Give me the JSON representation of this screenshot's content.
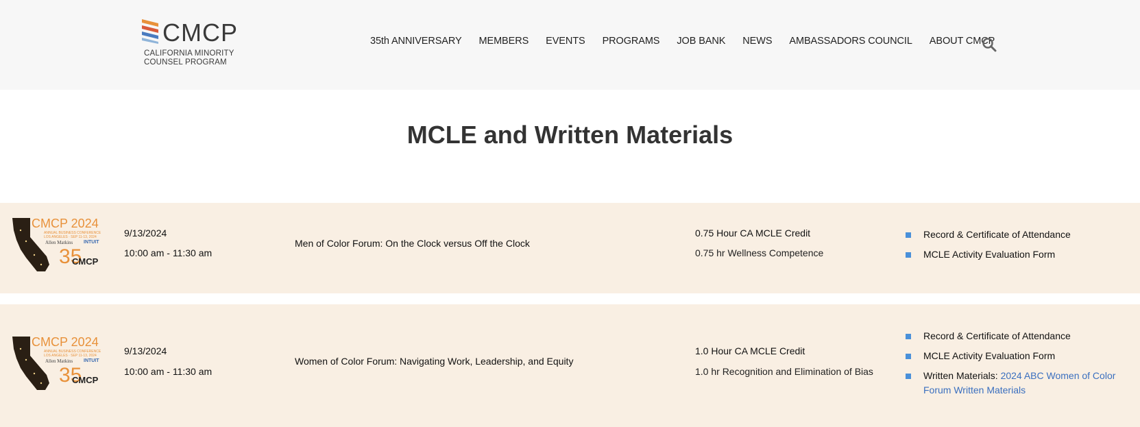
{
  "logo": {
    "word": "CMCP",
    "sub_line1": "CALIFORNIA MINORITY",
    "sub_line2": "COUNSEL PROGRAM",
    "stripe_colors": [
      "#e8913a",
      "#d95a3a",
      "#4a7bbf",
      "#8fb4d9"
    ]
  },
  "nav": {
    "items": [
      "35th ANNIVERSARY",
      "MEMBERS",
      "EVENTS",
      "PROGRAMS",
      "JOB BANK",
      "NEWS",
      "AMBASSADORS COUNCIL",
      "ABOUT CMCP"
    ],
    "search_icon": "search-icon"
  },
  "page": {
    "title": "MCLE and Written Materials"
  },
  "thumbnail": {
    "title": "CMCP 2024",
    "sub1": "ANNUAL BUSINESS CONFERENCE",
    "sub2": "LOS ANGELES · SEP 11-13, 2024",
    "sponsor1": "Allen Matkins",
    "sponsor2": "INTUIT",
    "anniv": "35",
    "anniv_word": "CMCP"
  },
  "events": [
    {
      "date": "9/13/2024",
      "time": "10:00 am - 11:30 am",
      "title": "Men of Color Forum: On the Clock versus Off the Clock",
      "credit": "0.75 Hour CA MCLE Credit",
      "credit_sub": "0.75 hr Wellness Competence",
      "links": [
        {
          "text": "Record & Certificate of Attendance"
        },
        {
          "text": "MCLE Activity Evaluation Form"
        }
      ]
    },
    {
      "date": "9/13/2024",
      "time": "10:00 am - 11:30 am",
      "title": "Women of Color Forum: Navigating Work, Leadership, and Equity",
      "credit": "1.0 Hour CA MCLE Credit",
      "credit_sub": "1.0 hr Recognition and Elimination of Bias",
      "links": [
        {
          "text": "Record & Certificate of Attendance"
        },
        {
          "text": "MCLE Activity Evaluation Form"
        },
        {
          "label": "Written Materials:",
          "link": "2024 ABC Women of Color Forum Written Materials"
        }
      ]
    }
  ],
  "colors": {
    "accent_blue": "#4a90d9",
    "link_blue": "#3a6fbf",
    "row_bg": "#f9efe3",
    "header_bg": "#f7f7f7",
    "orange": "#e8913a"
  }
}
